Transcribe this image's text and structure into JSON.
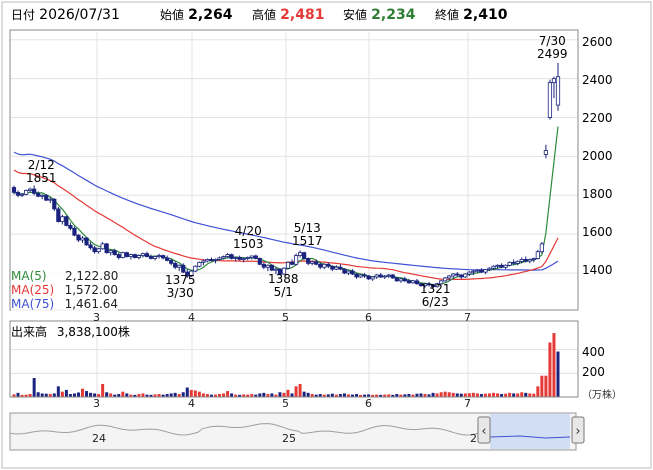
{
  "header": {
    "date_label": "日付",
    "date_value": "2026/07/31",
    "open_label": "始値",
    "open_value": "2,264",
    "high_label": "高値",
    "high_value": "2,481",
    "low_label": "安値",
    "low_value": "2,234",
    "close_label": "終値",
    "close_value": "2,410"
  },
  "colors": {
    "up_candle": "#ffffff",
    "down_candle": "#1a237e",
    "ma5": "#2e8b3a",
    "ma25": "#e53935",
    "ma75": "#3f51d4",
    "high_value": "#e53935",
    "low_value": "#2e7d32",
    "volume_up": "#e53935",
    "volume_down": "#1a237e"
  },
  "legend": {
    "ma5_label": "MA(5)",
    "ma5_value": "2,122.80",
    "ma25_label": "MA(25)",
    "ma25_value": "1,572.00",
    "ma75_label": "MA(75)",
    "ma75_value": "1,461.64"
  },
  "volume": {
    "title": "出来高",
    "value": "3,838,100株",
    "unit": "（万株）",
    "ticks": [
      "400",
      "200"
    ]
  },
  "navigator": {
    "ticks": [
      "24",
      "25",
      "2"
    ]
  },
  "chart_data": [
    {
      "type": "candlestick",
      "y_ticks": [
        "2600",
        "2400",
        "2200",
        "2000",
        "1800",
        "1600",
        "1400"
      ],
      "ylim": [
        1210,
        2640
      ],
      "x_ticks": [
        "3",
        "4",
        "5",
        "6",
        "7"
      ],
      "annotations": [
        {
          "date": "2/12",
          "value": "1851"
        },
        {
          "date": "3/30",
          "value": "1375"
        },
        {
          "date": "4/20",
          "value": "1503"
        },
        {
          "date": "5/1",
          "value": "1388"
        },
        {
          "date": "5/13",
          "value": "1517"
        },
        {
          "date": "6/23",
          "value": "1321"
        },
        {
          "date": "7/30",
          "value": "2499"
        }
      ],
      "series": [
        {
          "name": "MA(5)",
          "value": "2,122.80"
        },
        {
          "name": "MA(25)",
          "value": "1,572.00"
        },
        {
          "name": "MA(75)",
          "value": "1,461.64"
        }
      ],
      "candles": [
        [
          1840,
          1850,
          1805,
          1815
        ],
        [
          1815,
          1825,
          1790,
          1800
        ],
        [
          1800,
          1812,
          1790,
          1805
        ],
        [
          1805,
          1830,
          1800,
          1825
        ],
        [
          1825,
          1840,
          1815,
          1832
        ],
        [
          1832,
          1851,
          1800,
          1810
        ],
        [
          1810,
          1820,
          1790,
          1795
        ],
        [
          1795,
          1805,
          1780,
          1800
        ],
        [
          1800,
          1805,
          1770,
          1775
        ],
        [
          1775,
          1790,
          1760,
          1780
        ],
        [
          1780,
          1785,
          1720,
          1730
        ],
        [
          1730,
          1740,
          1660,
          1665
        ],
        [
          1665,
          1700,
          1650,
          1690
        ],
        [
          1690,
          1695,
          1640,
          1645
        ],
        [
          1645,
          1660,
          1620,
          1630
        ],
        [
          1630,
          1640,
          1590,
          1595
        ],
        [
          1595,
          1600,
          1560,
          1570
        ],
        [
          1570,
          1590,
          1555,
          1580
        ],
        [
          1580,
          1585,
          1540,
          1545
        ],
        [
          1545,
          1560,
          1520,
          1530
        ],
        [
          1530,
          1540,
          1500,
          1510
        ],
        [
          1510,
          1530,
          1500,
          1525
        ],
        [
          1525,
          1560,
          1520,
          1550
        ],
        [
          1550,
          1555,
          1500,
          1505
        ],
        [
          1505,
          1520,
          1490,
          1515
        ],
        [
          1515,
          1525,
          1490,
          1495
        ],
        [
          1495,
          1505,
          1470,
          1480
        ],
        [
          1480,
          1510,
          1475,
          1505
        ],
        [
          1505,
          1510,
          1480,
          1485
        ],
        [
          1485,
          1500,
          1470,
          1495
        ],
        [
          1495,
          1500,
          1475,
          1480
        ],
        [
          1480,
          1495,
          1470,
          1490
        ],
        [
          1490,
          1505,
          1480,
          1500
        ],
        [
          1500,
          1510,
          1480,
          1485
        ],
        [
          1485,
          1495,
          1470,
          1475
        ],
        [
          1475,
          1490,
          1465,
          1485
        ],
        [
          1485,
          1500,
          1475,
          1490
        ],
        [
          1490,
          1495,
          1470,
          1478
        ],
        [
          1478,
          1490,
          1460,
          1465
        ],
        [
          1465,
          1475,
          1440,
          1450
        ],
        [
          1450,
          1460,
          1420,
          1430
        ],
        [
          1430,
          1445,
          1410,
          1440
        ],
        [
          1440,
          1450,
          1400,
          1405
        ],
        [
          1405,
          1420,
          1375,
          1385
        ],
        [
          1385,
          1415,
          1380,
          1410
        ],
        [
          1410,
          1440,
          1405,
          1435
        ],
        [
          1435,
          1460,
          1430,
          1455
        ],
        [
          1455,
          1470,
          1440,
          1462
        ],
        [
          1462,
          1475,
          1455,
          1470
        ],
        [
          1470,
          1480,
          1460,
          1465
        ],
        [
          1465,
          1475,
          1450,
          1470
        ],
        [
          1470,
          1485,
          1465,
          1478
        ],
        [
          1478,
          1490,
          1470,
          1485
        ],
        [
          1485,
          1503,
          1475,
          1495
        ],
        [
          1495,
          1500,
          1470,
          1475
        ],
        [
          1475,
          1485,
          1460,
          1480
        ],
        [
          1480,
          1490,
          1465,
          1470
        ],
        [
          1470,
          1480,
          1455,
          1475
        ],
        [
          1475,
          1485,
          1465,
          1480
        ],
        [
          1480,
          1490,
          1470,
          1488
        ],
        [
          1488,
          1495,
          1470,
          1475
        ],
        [
          1475,
          1480,
          1440,
          1445
        ],
        [
          1445,
          1455,
          1420,
          1430
        ],
        [
          1430,
          1445,
          1410,
          1440
        ],
        [
          1440,
          1445,
          1410,
          1415
        ],
        [
          1415,
          1430,
          1395,
          1420
        ],
        [
          1420,
          1425,
          1388,
          1395
        ],
        [
          1395,
          1430,
          1390,
          1425
        ],
        [
          1425,
          1460,
          1420,
          1455
        ],
        [
          1455,
          1470,
          1440,
          1445
        ],
        [
          1445,
          1500,
          1440,
          1490
        ],
        [
          1490,
          1517,
          1480,
          1505
        ],
        [
          1505,
          1510,
          1470,
          1475
        ],
        [
          1475,
          1480,
          1440,
          1450
        ],
        [
          1450,
          1465,
          1440,
          1458
        ],
        [
          1458,
          1470,
          1440,
          1445
        ],
        [
          1445,
          1455,
          1420,
          1430
        ],
        [
          1430,
          1450,
          1420,
          1445
        ],
        [
          1445,
          1455,
          1425,
          1435
        ],
        [
          1435,
          1440,
          1410,
          1420
        ],
        [
          1420,
          1440,
          1415,
          1430
        ],
        [
          1430,
          1445,
          1415,
          1420
        ],
        [
          1420,
          1425,
          1395,
          1400
        ],
        [
          1400,
          1415,
          1390,
          1410
        ],
        [
          1410,
          1420,
          1390,
          1395
        ],
        [
          1395,
          1400,
          1370,
          1380
        ],
        [
          1380,
          1395,
          1375,
          1390
        ],
        [
          1390,
          1400,
          1375,
          1385
        ],
        [
          1385,
          1390,
          1365,
          1370
        ],
        [
          1370,
          1385,
          1360,
          1380
        ],
        [
          1380,
          1395,
          1370,
          1390
        ],
        [
          1390,
          1400,
          1375,
          1380
        ],
        [
          1380,
          1390,
          1370,
          1385
        ],
        [
          1385,
          1395,
          1375,
          1390
        ],
        [
          1390,
          1395,
          1370,
          1375
        ],
        [
          1375,
          1380,
          1355,
          1360
        ],
        [
          1360,
          1375,
          1350,
          1370
        ],
        [
          1370,
          1380,
          1355,
          1360
        ],
        [
          1360,
          1370,
          1345,
          1350
        ],
        [
          1350,
          1365,
          1345,
          1360
        ],
        [
          1360,
          1370,
          1340,
          1345
        ],
        [
          1345,
          1350,
          1330,
          1335
        ],
        [
          1335,
          1350,
          1325,
          1345
        ],
        [
          1345,
          1355,
          1330,
          1340
        ],
        [
          1340,
          1345,
          1321,
          1330
        ],
        [
          1330,
          1350,
          1325,
          1345
        ],
        [
          1345,
          1365,
          1340,
          1360
        ],
        [
          1360,
          1380,
          1355,
          1375
        ],
        [
          1375,
          1390,
          1360,
          1385
        ],
        [
          1385,
          1400,
          1370,
          1395
        ],
        [
          1395,
          1405,
          1380,
          1390
        ],
        [
          1390,
          1395,
          1370,
          1380
        ],
        [
          1380,
          1400,
          1375,
          1395
        ],
        [
          1395,
          1410,
          1385,
          1405
        ],
        [
          1405,
          1415,
          1390,
          1410
        ],
        [
          1410,
          1420,
          1400,
          1415
        ],
        [
          1415,
          1425,
          1400,
          1405
        ],
        [
          1405,
          1420,
          1395,
          1418
        ],
        [
          1418,
          1430,
          1410,
          1425
        ],
        [
          1425,
          1440,
          1415,
          1435
        ],
        [
          1435,
          1445,
          1425,
          1440
        ],
        [
          1440,
          1450,
          1425,
          1430
        ],
        [
          1430,
          1445,
          1420,
          1440
        ],
        [
          1440,
          1460,
          1435,
          1455
        ],
        [
          1455,
          1470,
          1440,
          1450
        ],
        [
          1450,
          1465,
          1440,
          1460
        ],
        [
          1460,
          1480,
          1450,
          1470
        ],
        [
          1470,
          1485,
          1455,
          1462
        ],
        [
          1462,
          1475,
          1450,
          1470
        ],
        [
          1470,
          1480,
          1455,
          1475
        ],
        [
          1475,
          1520,
          1470,
          1510
        ],
        [
          1510,
          1560,
          1500,
          1550
        ],
        [
          2010,
          2060,
          1990,
          2030
        ],
        [
          2200,
          2395,
          2190,
          2380
        ],
        [
          2380,
          2410,
          2300,
          2400
        ],
        [
          2264,
          2481,
          2234,
          2410
        ]
      ],
      "volumes": [
        [
          22,
          1
        ],
        [
          35,
          0
        ],
        [
          18,
          1
        ],
        [
          20,
          1
        ],
        [
          25,
          1
        ],
        [
          160,
          0
        ],
        [
          40,
          0
        ],
        [
          30,
          0
        ],
        [
          28,
          0
        ],
        [
          25,
          1
        ],
        [
          30,
          0
        ],
        [
          90,
          0
        ],
        [
          45,
          1
        ],
        [
          60,
          0
        ],
        [
          25,
          0
        ],
        [
          30,
          0
        ],
        [
          38,
          0
        ],
        [
          70,
          1
        ],
        [
          50,
          0
        ],
        [
          35,
          0
        ],
        [
          30,
          0
        ],
        [
          25,
          1
        ],
        [
          110,
          1
        ],
        [
          40,
          0
        ],
        [
          30,
          1
        ],
        [
          20,
          0
        ],
        [
          25,
          0
        ],
        [
          45,
          1
        ],
        [
          30,
          0
        ],
        [
          20,
          1
        ],
        [
          18,
          0
        ],
        [
          25,
          1
        ],
        [
          30,
          1
        ],
        [
          20,
          0
        ],
        [
          18,
          0
        ],
        [
          22,
          1
        ],
        [
          25,
          1
        ],
        [
          20,
          0
        ],
        [
          25,
          0
        ],
        [
          30,
          0
        ],
        [
          35,
          0
        ],
        [
          25,
          1
        ],
        [
          40,
          0
        ],
        [
          80,
          0
        ],
        [
          60,
          1
        ],
        [
          55,
          1
        ],
        [
          45,
          1
        ],
        [
          30,
          1
        ],
        [
          25,
          1
        ],
        [
          20,
          0
        ],
        [
          20,
          1
        ],
        [
          25,
          1
        ],
        [
          30,
          1
        ],
        [
          50,
          1
        ],
        [
          30,
          0
        ],
        [
          20,
          1
        ],
        [
          18,
          0
        ],
        [
          22,
          1
        ],
        [
          20,
          1
        ],
        [
          25,
          1
        ],
        [
          20,
          0
        ],
        [
          30,
          0
        ],
        [
          35,
          0
        ],
        [
          25,
          1
        ],
        [
          30,
          0
        ],
        [
          20,
          1
        ],
        [
          40,
          0
        ],
        [
          35,
          1
        ],
        [
          60,
          1
        ],
        [
          30,
          0
        ],
        [
          90,
          1
        ],
        [
          110,
          1
        ],
        [
          45,
          0
        ],
        [
          35,
          0
        ],
        [
          25,
          1
        ],
        [
          20,
          0
        ],
        [
          25,
          0
        ],
        [
          20,
          1
        ],
        [
          22,
          0
        ],
        [
          28,
          0
        ],
        [
          20,
          1
        ],
        [
          25,
          0
        ],
        [
          30,
          0
        ],
        [
          22,
          1
        ],
        [
          20,
          0
        ],
        [
          25,
          0
        ],
        [
          18,
          1
        ],
        [
          20,
          0
        ],
        [
          22,
          0
        ],
        [
          18,
          1
        ],
        [
          20,
          1
        ],
        [
          18,
          0
        ],
        [
          20,
          1
        ],
        [
          22,
          1
        ],
        [
          18,
          0
        ],
        [
          25,
          0
        ],
        [
          20,
          1
        ],
        [
          22,
          0
        ],
        [
          25,
          0
        ],
        [
          20,
          1
        ],
        [
          28,
          0
        ],
        [
          30,
          0
        ],
        [
          25,
          1
        ],
        [
          22,
          0
        ],
        [
          35,
          0
        ],
        [
          30,
          1
        ],
        [
          40,
          1
        ],
        [
          45,
          1
        ],
        [
          40,
          1
        ],
        [
          35,
          1
        ],
        [
          30,
          0
        ],
        [
          28,
          0
        ],
        [
          30,
          1
        ],
        [
          32,
          1
        ],
        [
          35,
          1
        ],
        [
          30,
          1
        ],
        [
          25,
          0
        ],
        [
          28,
          1
        ],
        [
          30,
          1
        ],
        [
          35,
          1
        ],
        [
          30,
          1
        ],
        [
          25,
          0
        ],
        [
          28,
          1
        ],
        [
          35,
          1
        ],
        [
          30,
          0
        ],
        [
          30,
          1
        ],
        [
          40,
          1
        ],
        [
          35,
          0
        ],
        [
          30,
          1
        ],
        [
          28,
          1
        ],
        [
          90,
          1
        ],
        [
          180,
          1
        ],
        [
          180,
          1
        ],
        [
          460,
          1
        ],
        [
          540,
          1
        ],
        [
          384,
          0
        ]
      ]
    }
  ]
}
